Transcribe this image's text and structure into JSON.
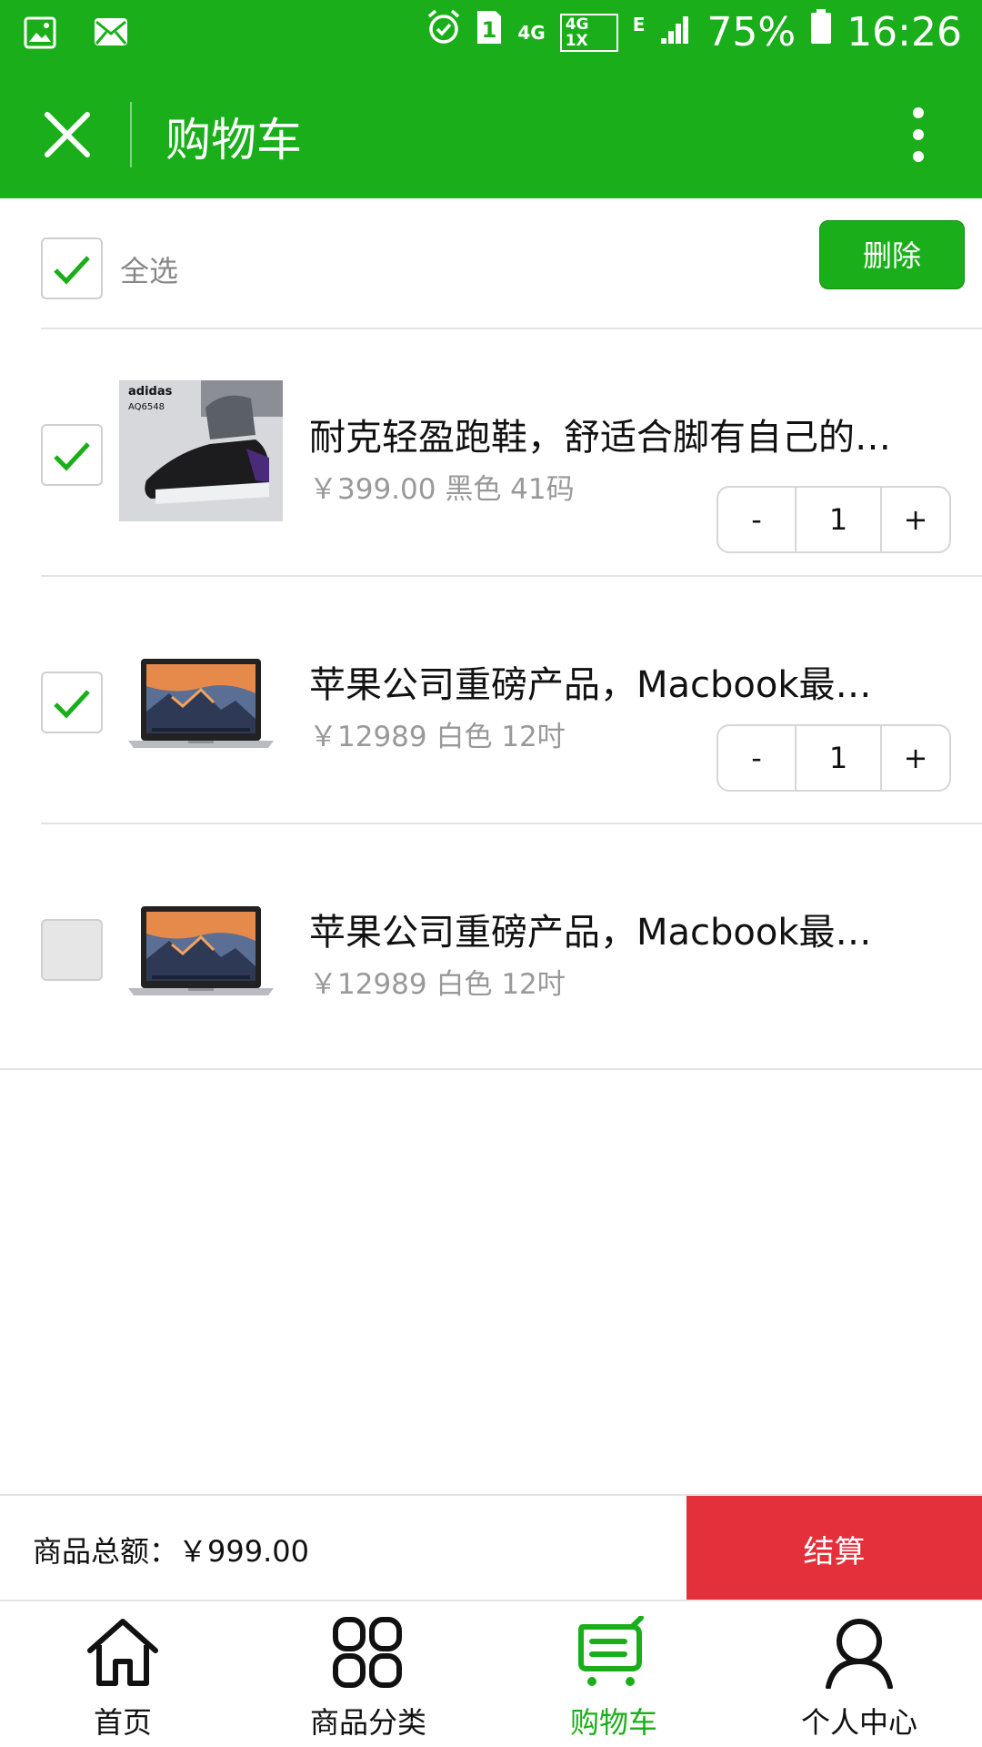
{
  "status_bar": {
    "battery": "75%",
    "time": "16:26",
    "network_4g": "4G",
    "network_4g_1x": "4G 1X",
    "network_e": "E",
    "sim_badge": "1",
    "icons": [
      "image-icon",
      "mail-icon",
      "alarm-icon",
      "sim-icon",
      "signal-icon",
      "battery-icon"
    ]
  },
  "header": {
    "title": "购物车",
    "left_icon": "close-icon",
    "right_icon": "more-vertical-icon"
  },
  "cart": {
    "select_all_label": "全选",
    "select_all_checked": true,
    "delete_label": "删除",
    "items": [
      {
        "name": "耐克轻盈跑鞋，舒适合脚有自己的…",
        "price": "￥399.00 黑色 41码",
        "checked": true,
        "quantity": "1",
        "minus_label": "-",
        "plus_label": "+",
        "thumb_text": "adidas",
        "thumb_code": "AQ6548"
      },
      {
        "name": "苹果公司重磅产品，Macbook最…",
        "price": "￥12989 白色 12吋",
        "checked": true,
        "quantity": "1",
        "minus_label": "-",
        "plus_label": "+"
      },
      {
        "name": "苹果公司重磅产品，Macbook最…",
        "price": "￥12989 白色 12吋",
        "checked": false
      }
    ]
  },
  "footer": {
    "total_label": "商品总额：￥999.00",
    "checkout_label": "结算"
  },
  "tabbar": {
    "tabs": [
      {
        "label": "首页",
        "icon": "home-icon",
        "active": false
      },
      {
        "label": "商品分类",
        "icon": "category-icon",
        "active": false
      },
      {
        "label": "购物车",
        "icon": "cart-icon",
        "active": true
      },
      {
        "label": "个人中心",
        "icon": "user-icon",
        "active": false
      }
    ]
  },
  "colors": {
    "primary_green": "#1aaf1a",
    "checkout_red": "#e3303a",
    "muted_text": "#999999"
  }
}
